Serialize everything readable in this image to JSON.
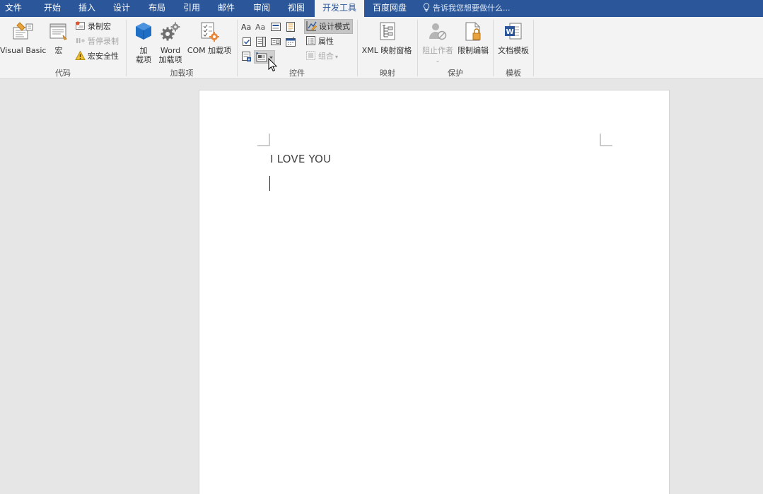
{
  "tabs": [
    {
      "label": "文件",
      "active": false
    },
    {
      "label": "开始",
      "active": false
    },
    {
      "label": "插入",
      "active": false
    },
    {
      "label": "设计",
      "active": false
    },
    {
      "label": "布局",
      "active": false
    },
    {
      "label": "引用",
      "active": false
    },
    {
      "label": "邮件",
      "active": false
    },
    {
      "label": "审阅",
      "active": false
    },
    {
      "label": "视图",
      "active": false
    },
    {
      "label": "开发工具",
      "active": true
    },
    {
      "label": "百度网盘",
      "active": false
    }
  ],
  "tell_me": "告诉我您想要做什么...",
  "ribbon": {
    "code": {
      "label": "代码",
      "visual_basic": "Visual Basic",
      "macros": "宏",
      "record_macro": "录制宏",
      "pause_recording": "暂停录制",
      "macro_security": "宏安全性"
    },
    "addins": {
      "label": "加载项",
      "addins_line1": "加",
      "addins_line2": "载项",
      "word_addins_line1": "Word",
      "word_addins_line2": "加载项",
      "com_addins": "COM 加载项"
    },
    "controls": {
      "label": "控件",
      "design_mode": "设计模式",
      "properties": "属性",
      "group": "组合"
    },
    "mapping": {
      "label": "映射",
      "xml_mapping_pane": "XML 映射窗格"
    },
    "protect": {
      "label": "保护",
      "block_authors": "阻止作者",
      "restrict_editing": "限制编辑"
    },
    "templates": {
      "label": "模板",
      "document_template": "文档模板"
    }
  },
  "document": {
    "text": "I LOVE YOU"
  },
  "colors": {
    "tabbar": "#2b579a",
    "ribbon": "#f3f3f3",
    "workspace": "#e6e6e6",
    "accent_orange": "#e8a33c",
    "accent_blue": "#1f6fc5"
  }
}
